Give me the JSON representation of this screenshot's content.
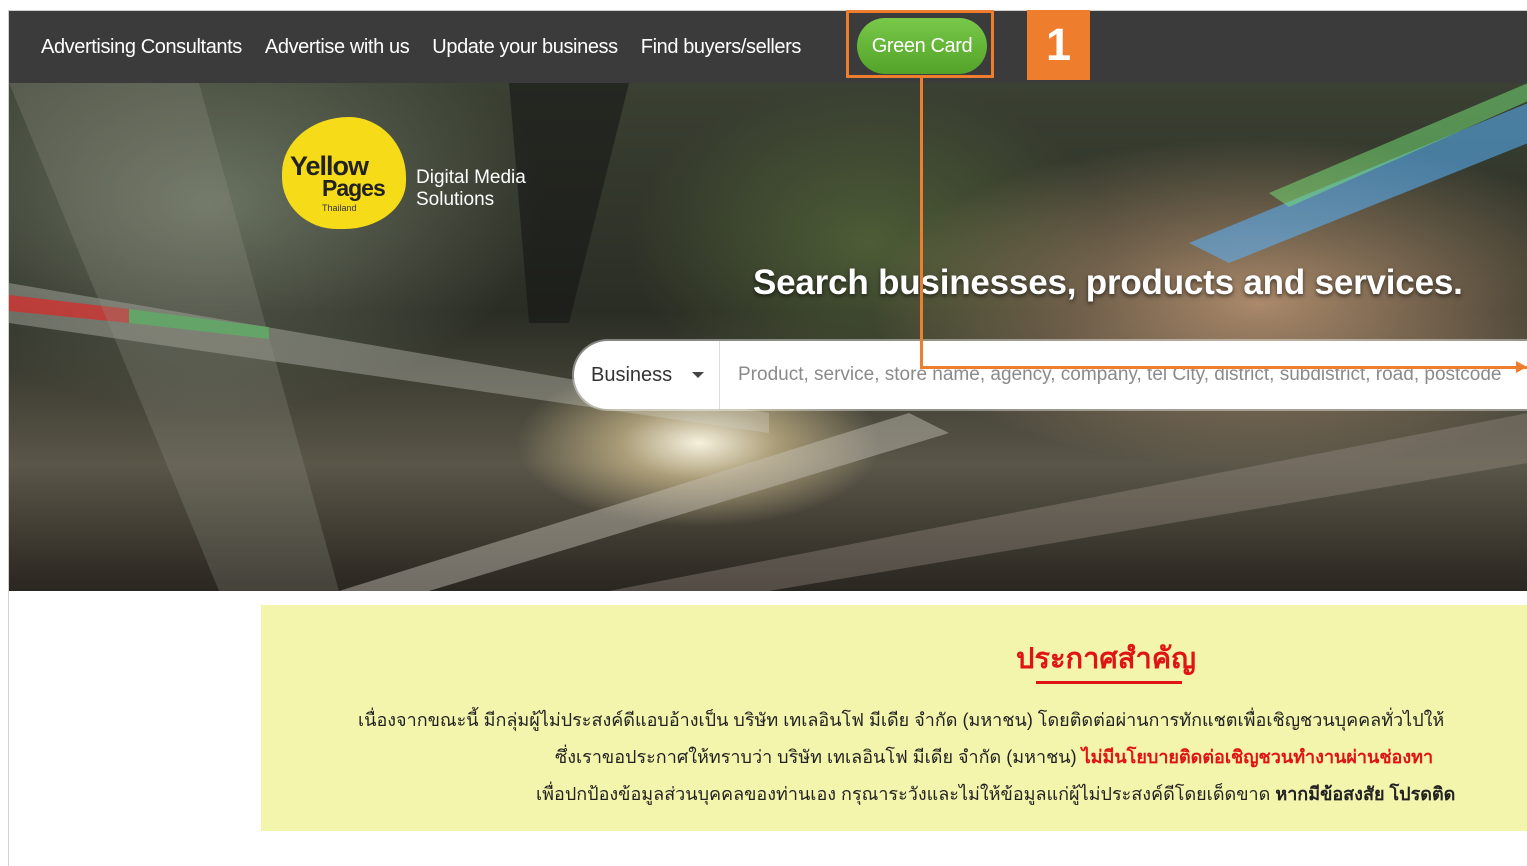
{
  "nav": {
    "links": [
      "Advertising Consultants",
      "Advertise with us",
      "Update your business",
      "Find buyers/sellers"
    ],
    "green_card_label": "Green Card"
  },
  "logo": {
    "word1": "Yellow",
    "word2": "Pages",
    "country": "Thailand",
    "tag_line1": "Digital Media",
    "tag_line2": "Solutions"
  },
  "hero": {
    "title": "Search businesses, products and services.",
    "category_selected": "Business",
    "search_placeholder": "Product, service, store name, agency, company, tel City, district, subdistrict, road, postcode"
  },
  "notice": {
    "title": "ประกาศสำคัญ",
    "line1": "เนื่องจากขณะนี้ มีกลุ่มผู้ไม่ประสงค์ดีแอบอ้างเป็น บริษัท เทเลอินโฟ มีเดีย จำกัด (มหาชน) โดยติดต่อผ่านการทักแชตเพื่อเชิญชวนบุคคลทั่วไปให้",
    "line2_plain": "ซึ่งเราขอประกาศให้ทราบว่า บริษัท เทเลอินโฟ มีเดีย จำกัด (มหาชน) ",
    "line2_red": "ไม่มีนโยบายติดต่อเชิญชวนทำงานผ่านช่องทา",
    "line3_plain": "เพื่อปกป้องข้อมูลส่วนบุคคลของท่านเอง กรุณาระวังและไม่ให้ข้อมูลแก่ผู้ไม่ประสงค์ดีโดยเด็ดขาด ",
    "line3_bold": "หากมีข้อสงสัย โปรดติด"
  },
  "annotation": {
    "step_number": "1",
    "color": "#ee7d2d"
  },
  "colors": {
    "nav_bg": "#3b3b3b",
    "green_button": "#5cb230",
    "notice_bg": "#f4f5ad",
    "notice_red": "#e01414",
    "logo_yellow": "#f6dc18"
  }
}
